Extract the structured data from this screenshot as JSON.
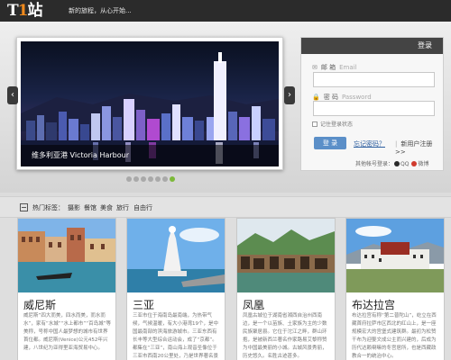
{
  "header": {
    "logo_prefix": "T",
    "logo_accent": "1",
    "logo_suffix": "站",
    "slogan": "新的旅程，从心开始..."
  },
  "slider": {
    "caption": "维多利亚港 Victoria Harbour",
    "prev_label": "‹",
    "next_label": "›",
    "dot_count": 7,
    "active_dot_index": 6
  },
  "login": {
    "title": "登录",
    "email_label": "邮 箱",
    "email_placeholder": "Email",
    "password_label": "密 码",
    "password_placeholder": "Password",
    "remember_label": "记住登录状态",
    "login_button": "登 录",
    "forgot_link": "忘记密码？",
    "register_link": "新用户注册>>",
    "other_login_label": "其他帐号登录：",
    "qq_label": "QQ",
    "weibo_label": "微博"
  },
  "tags": {
    "title": "热门标签：",
    "items": [
      "摄影",
      "餐馆",
      "美食",
      "旅行",
      "自由行"
    ]
  },
  "destinations": [
    {
      "title": "威尼斯",
      "desc": "威尼斯”四大而美，四水而美，而水而水”，家有“水城”“水上都市”“百岛城”等美称，号称中国人最梦想的城市有世界首位都。威尼斯(Venice)公元452年兴建，八世纪为亚得里亚海贸易中心。"
    },
    {
      "title": "三亚",
      "desc": "三亚市位于海南岛最南端，为热带气候，气候温暖，有大小港湾19个，是中国最南部的滨海旅游城市。三亚东西有长丰等大型综合运动会，成了“京都”。都集在“三亚”，南山海上观音圣像位于三亚市西南20公里处，乃是世界著名景点。"
    },
    {
      "title": "凤凰",
      "desc": "凤凰古城位于湖南省湘西自治州西南边，是一个以苗族、土家族为主的少数民族聚居县。它位于沱江之畔，群山环抱，是被新西兰著名作家路易艾黎称赞为中国最美丽的小城。古城风景秀丽，历史悠久。名胜古迹甚多。"
    },
    {
      "title": "布达拉宫",
      "desc": "布达拉宫有称“第二普陀山”，屹立在西藏首府拉萨市区西北的红山上，是一座规模宏大的宫堡式建筑群。最初为松赞干布为迎娶文成公主而兴建的，后成为历代达赖喇嘛的冬宫居所，也是西藏政教合一的统治中心。"
    }
  ],
  "colors": {
    "topbar": "#2b2b2b",
    "logo_accent": "#f08a1c",
    "login_button": "#5b8fc8",
    "active_dot": "#7cb93a"
  },
  "icons": {
    "email": "envelope-icon",
    "password": "lock-icon",
    "tags": "tag-list-icon"
  }
}
